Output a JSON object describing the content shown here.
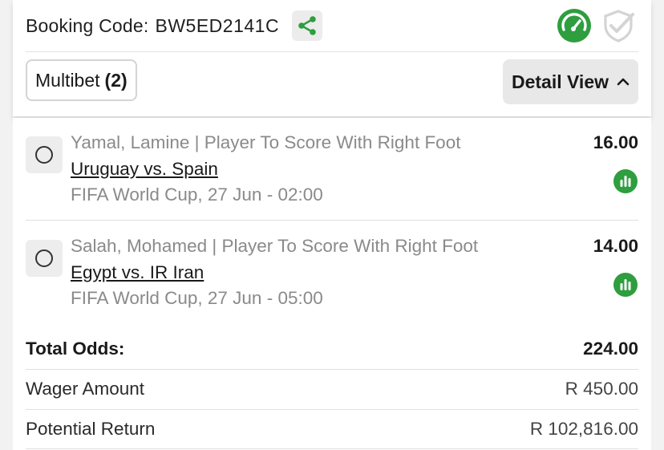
{
  "header": {
    "booking_label": "Booking Code:",
    "booking_code": "BW5ED2141C",
    "multibet_label": "Multibet",
    "multibet_count": "(2)",
    "detail_view_label": "Detail View"
  },
  "colors": {
    "accent_green": "#2e9e3e",
    "muted_text": "#8a8a8a"
  },
  "bets": [
    {
      "selection": "Yamal, Lamine | Player To Score With Right Foot",
      "match": "Uruguay vs. Spain",
      "competition": "FIFA World Cup, 27 Jun - 02:00",
      "odds": "16.00"
    },
    {
      "selection": "Salah, Mohamed | Player To Score With Right Foot",
      "match": "Egypt vs. IR Iran",
      "competition": "FIFA World Cup, 27 Jun - 05:00",
      "odds": "14.00"
    }
  ],
  "summary": {
    "total_odds_label": "Total Odds:",
    "total_odds_value": "224.00",
    "wager_label": "Wager Amount",
    "wager_value": "R 450.00",
    "return_label": "Potential Return",
    "return_value": "R 102,816.00"
  }
}
